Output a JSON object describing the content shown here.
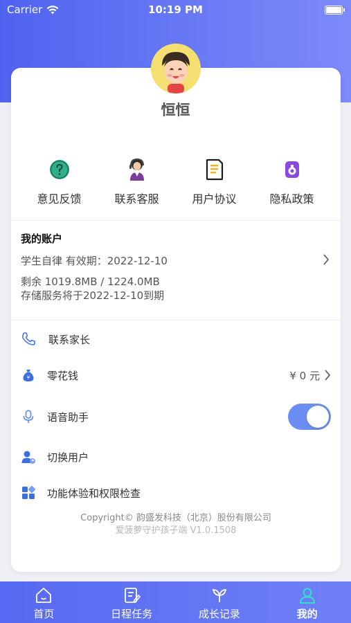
{
  "status_bar": {
    "carrier": "Carrier",
    "time": "10:19 PM"
  },
  "user": {
    "name": "恒恒"
  },
  "quick_actions": [
    {
      "label": "意见反馈",
      "icon": "feedback-icon"
    },
    {
      "label": "联系客服",
      "icon": "customer-service-icon"
    },
    {
      "label": "用户协议",
      "icon": "user-agreement-icon"
    },
    {
      "label": "隐私政策",
      "icon": "privacy-policy-icon"
    }
  ],
  "account": {
    "title": "我的账户",
    "plan": "学生自律   有效期：2022-12-10",
    "remaining": "剩余 1019.8MB / 1224.0MB",
    "expire": "存储服务将于2022-12-10到期"
  },
  "menu": {
    "contact_parent": "联系家长",
    "pocket_money": "零花钱",
    "pocket_money_value": "¥ 0 元",
    "voice_assistant": "语音助手",
    "voice_assistant_on": true,
    "switch_user": "切换用户",
    "feature_check": "功能体验和权限检查"
  },
  "footer": {
    "copyright": "Copyright© 韵盛发科技（北京）股份有限公司",
    "version": "爱菠萝守护孩子端 V1.0.1508"
  },
  "tabs": [
    {
      "label": "首页",
      "icon": "home-icon"
    },
    {
      "label": "日程任务",
      "icon": "schedule-icon"
    },
    {
      "label": "成长记录",
      "icon": "growth-icon"
    },
    {
      "label": "我的",
      "icon": "profile-icon"
    }
  ],
  "colors": {
    "accent": "#5669f2",
    "toggle_on": "#6c8ef3"
  }
}
